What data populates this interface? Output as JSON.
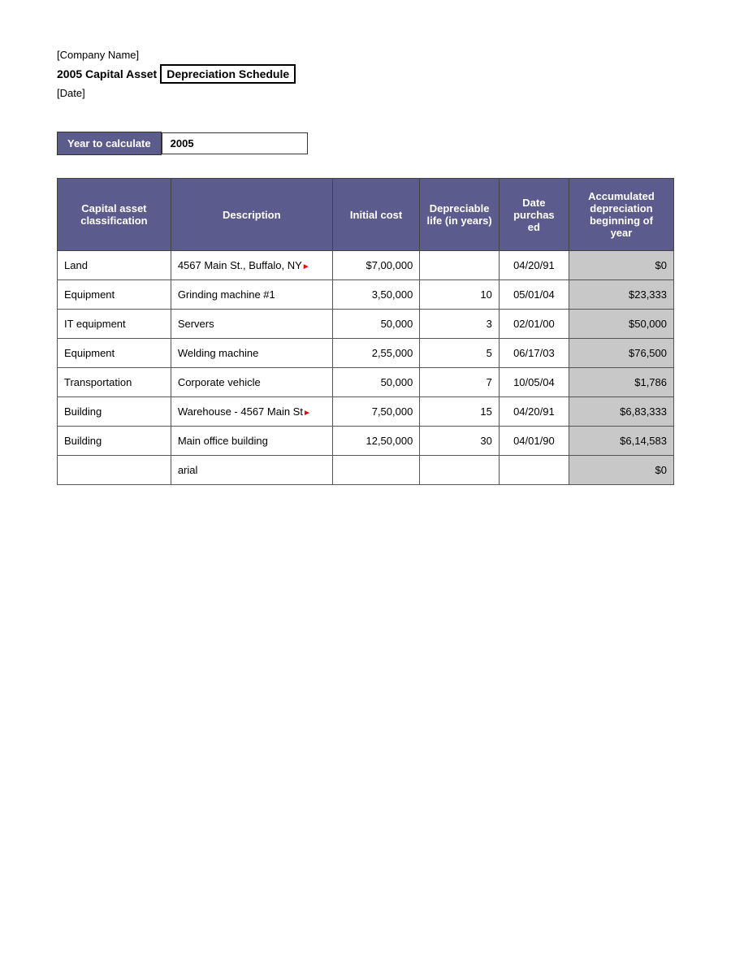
{
  "header": {
    "company_name": "[Company Name]",
    "title_part1": "2005 Capital Asset",
    "title_part2": "Depreciation Schedule",
    "date": "[Date]"
  },
  "year_section": {
    "label": "Year to calculate",
    "value": "2005"
  },
  "table": {
    "columns": [
      {
        "id": "classification",
        "label": "Capital asset\nclassification"
      },
      {
        "id": "description",
        "label": "Description"
      },
      {
        "id": "initial_cost",
        "label": "Initial cost"
      },
      {
        "id": "depr_life",
        "label": "Depreciable\nlife (in years)"
      },
      {
        "id": "date_purchased",
        "label": "Date\npurchased"
      },
      {
        "id": "accum_depr",
        "label": "Accumulated\ndepreciation\nbeginning of\nyear"
      }
    ],
    "rows": [
      {
        "classification": "Land",
        "description": "4567 Main St., Buffalo, NY",
        "initial_cost": "$7,00,000",
        "depr_life": "",
        "date_purchased": "04/20/91",
        "accum_depr": "$0"
      },
      {
        "classification": "Equipment",
        "description": "Grinding machine #1",
        "initial_cost": "3,50,000",
        "depr_life": "10",
        "date_purchased": "05/01/04",
        "accum_depr": "$23,333"
      },
      {
        "classification": "IT equipment",
        "description": "Servers",
        "initial_cost": "50,000",
        "depr_life": "3",
        "date_purchased": "02/01/00",
        "accum_depr": "$50,000"
      },
      {
        "classification": "Equipment",
        "description": "Welding machine",
        "initial_cost": "2,55,000",
        "depr_life": "5",
        "date_purchased": "06/17/03",
        "accum_depr": "$76,500"
      },
      {
        "classification": "Transportation",
        "description": "Corporate vehicle",
        "initial_cost": "50,000",
        "depr_life": "7",
        "date_purchased": "10/05/04",
        "accum_depr": "$1,786"
      },
      {
        "classification": "Building",
        "description": "Warehouse - 4567 Main St",
        "initial_cost": "7,50,000",
        "depr_life": "15",
        "date_purchased": "04/20/91",
        "accum_depr": "$6,83,333"
      },
      {
        "classification": "Building",
        "description": "Main office building",
        "initial_cost": "12,50,000",
        "depr_life": "30",
        "date_purchased": "04/01/90",
        "accum_depr": "$6,14,583"
      },
      {
        "classification": "",
        "description": "arial",
        "initial_cost": "",
        "depr_life": "",
        "date_purchased": "",
        "accum_depr": "$0"
      }
    ]
  }
}
